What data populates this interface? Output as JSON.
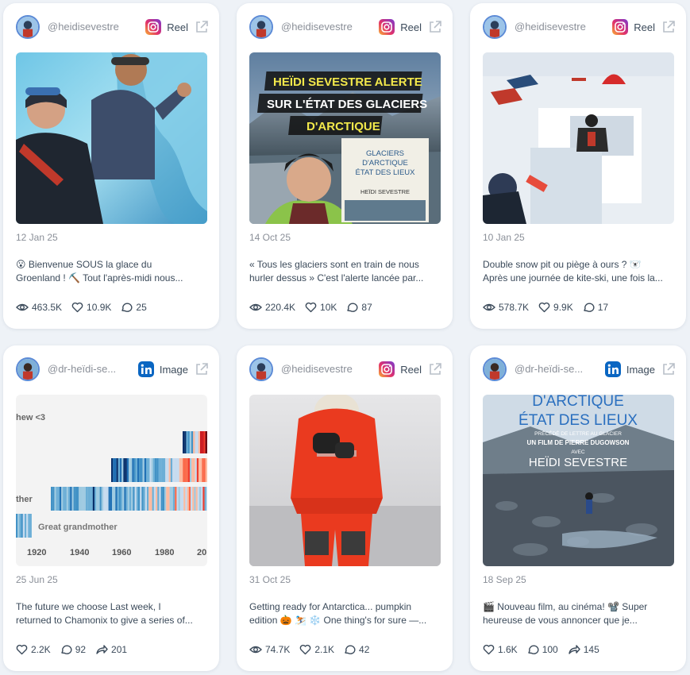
{
  "cards": [
    {
      "handle": "@heidisevestre",
      "platform": "Reel",
      "platform_icon": "instagram-icon",
      "date": "12 Jan 25",
      "caption_1": "😮 Bienvenue SOUS la glace du",
      "caption_2": "Groenland ! ⛏️ Tout l'après-midi nous...",
      "stats": [
        "463.5K",
        "10.9K",
        "25"
      ],
      "stat_icons": [
        "eye-icon",
        "heart-icon",
        "comment-icon"
      ]
    },
    {
      "handle": "@heidisevestre",
      "platform": "Reel",
      "platform_icon": "instagram-icon",
      "thumb_text_1": "HEÏDI SEVESTRE ALERTE",
      "thumb_text_2": "SUR L'ÉTAT DES GLACIERS",
      "thumb_text_3": "D'ARCTIQUE",
      "book_title_1": "GLACIERS",
      "book_title_2": "D'ARCTIQUE",
      "book_title_3": "ÉTAT DES LIEUX",
      "book_author": "HEÏDI SEVESTRE",
      "date": "14 Oct 25",
      "caption_1": "« Tous les glaciers sont en train de nous",
      "caption_2": "hurler dessus » C'est l'alerte lancée par...",
      "stats": [
        "220.4K",
        "10K",
        "87"
      ],
      "stat_icons": [
        "eye-icon",
        "heart-icon",
        "comment-icon"
      ]
    },
    {
      "handle": "@heidisevestre",
      "platform": "Reel",
      "platform_icon": "instagram-icon",
      "date": "10 Jan 25",
      "caption_1": "Double snow pit ou piège à ours ? 🐻‍❄️",
      "caption_2": "Après une journée de kite-ski, une fois la...",
      "stats": [
        "578.7K",
        "9.9K",
        "17"
      ],
      "stat_icons": [
        "eye-icon",
        "heart-icon",
        "comment-icon"
      ]
    },
    {
      "handle": "@dr-heïdi-se...",
      "platform": "Image",
      "platform_icon": "linkedin-icon",
      "thumb_text_1": "hew <3",
      "thumb_text_2": "ther",
      "thumb_text_3": "Great grandmother",
      "thumb_years": [
        "1920",
        "1940",
        "1960",
        "1980",
        "20"
      ],
      "date": "25 Jun 25",
      "caption_1": "The future we choose Last week, I",
      "caption_2": "returned to Chamonix to give a series of...",
      "stats": [
        "2.2K",
        "92",
        "201"
      ],
      "stat_icons": [
        "heart-icon",
        "comment-icon",
        "share-icon"
      ]
    },
    {
      "handle": "@heidisevestre",
      "platform": "Reel",
      "platform_icon": "instagram-icon",
      "date": "31 Oct 25",
      "caption_1": "Getting ready for Antarctica... pumpkin",
      "caption_2": "edition 🎃 ⛷️ ❄️ One thing's for sure —...",
      "stats": [
        "74.7K",
        "2.1K",
        "42"
      ],
      "stat_icons": [
        "eye-icon",
        "heart-icon",
        "comment-icon"
      ]
    },
    {
      "handle": "@dr-heïdi-se...",
      "platform": "Image",
      "platform_icon": "linkedin-icon",
      "thumb_text_1": "D'ARCTIQUE",
      "thumb_text_2": "ÉTAT DES LIEUX",
      "thumb_text_3": "PRÉCÉDÉ DE LETTRE AU GLACIER",
      "thumb_text_4": "UN FILM DE PIERRE DUGOWSON",
      "thumb_text_5": "AVEC",
      "thumb_text_6": "HEÏDI SEVESTRE",
      "date": "18 Sep 25",
      "caption_1": "🎬 Nouveau film, au cinéma! 📽️ Super",
      "caption_2": "heureuse de vous annoncer que je...",
      "stats": [
        "1.6K",
        "100",
        "145"
      ],
      "stat_icons": [
        "heart-icon",
        "comment-icon",
        "share-icon"
      ]
    }
  ],
  "colors": {
    "accent": "#5b8ad6",
    "linkedin": "#0a66c2"
  }
}
